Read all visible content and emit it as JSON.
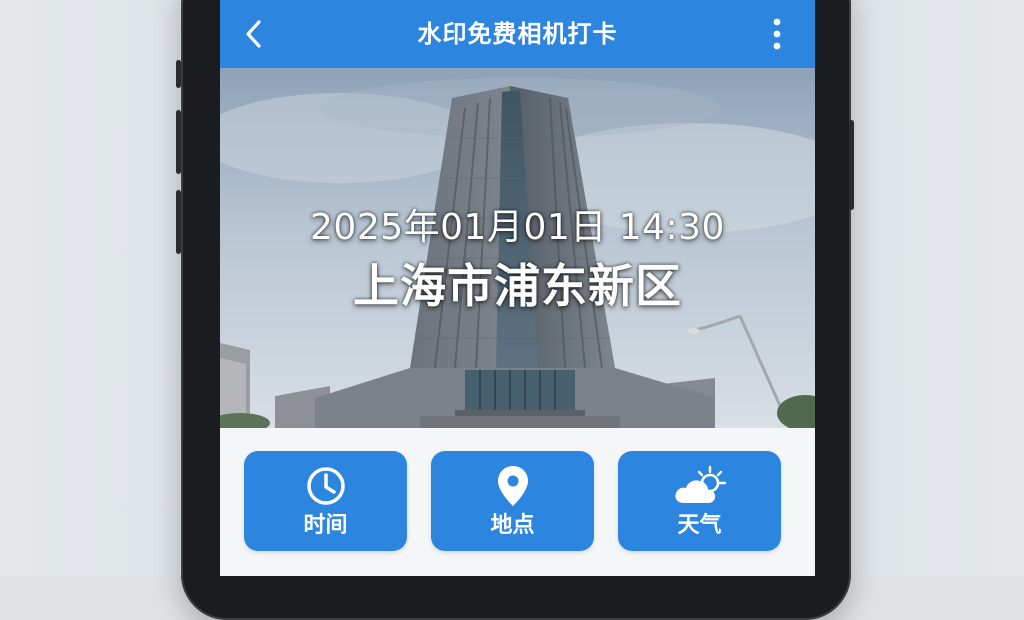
{
  "app": {
    "title": "水印免费相机打卡"
  },
  "appbar": {
    "back_icon": "chevron-left-icon",
    "more_icon": "more-vertical-icon"
  },
  "photo": {
    "watermark_time": "2025年01月01日 14:30",
    "watermark_location": "上海市浦东新区"
  },
  "actions": [
    {
      "label": "时间",
      "icon": "clock-icon"
    },
    {
      "label": "地点",
      "icon": "location-pin-icon"
    },
    {
      "label": "天气",
      "icon": "weather-partly-cloudy-icon"
    }
  ],
  "colors": {
    "primary": "#2c85df",
    "screen_bg": "#f4f6f8",
    "phone_frame": "#1b1c1f"
  }
}
